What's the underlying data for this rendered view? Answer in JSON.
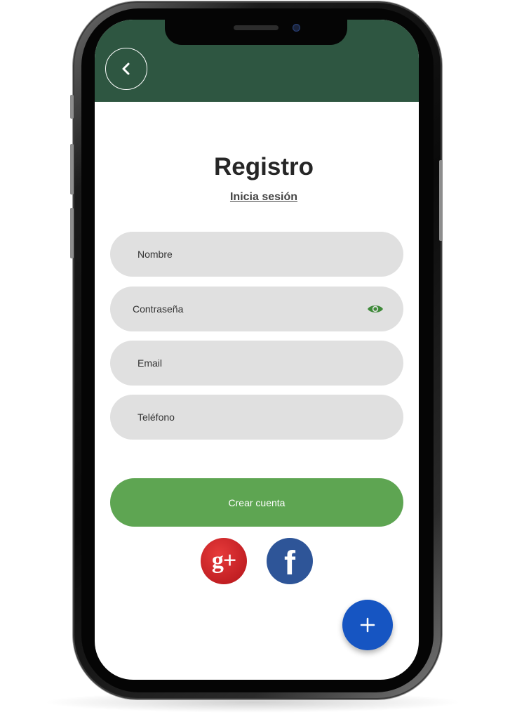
{
  "header": {
    "back_icon": "chevron-left-icon",
    "color": "#2e5641"
  },
  "page": {
    "title": "Registro",
    "login_link": "Inicia sesión"
  },
  "form": {
    "name_label": "Nombre",
    "password_label": "Contraseña",
    "password_toggle_icon": "eye-icon",
    "email_label": "Email",
    "phone_label": "Teléfono",
    "submit_label": "Crear cuenta",
    "submit_color": "#5ea552",
    "field_color": "#e0e0e0"
  },
  "social": {
    "google_icon": "google-plus-icon",
    "google_text": "g+",
    "google_color": "#d61f26",
    "facebook_icon": "facebook-icon",
    "facebook_text": "f",
    "facebook_color": "#2e5598"
  },
  "fab": {
    "icon": "plus-icon",
    "color": "#1655c2"
  }
}
